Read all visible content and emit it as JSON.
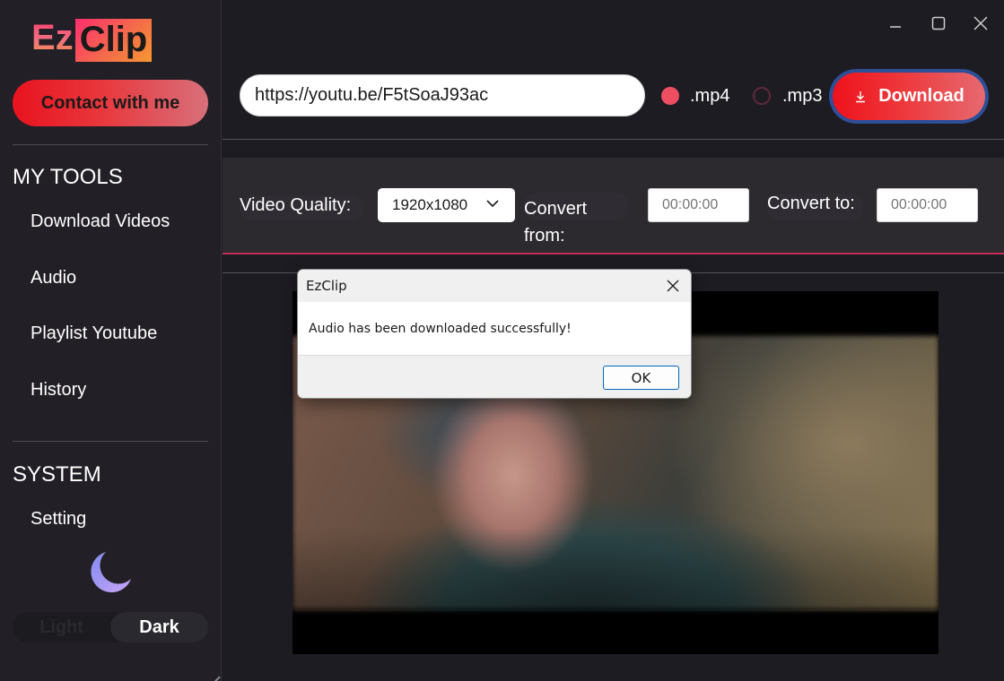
{
  "app": {
    "logo_left": "Ez",
    "logo_right": "Clip"
  },
  "sidebar": {
    "contact_label": "Contact with me",
    "tools_heading": "MY TOOLS",
    "tools": [
      {
        "label": "Download Videos"
      },
      {
        "label": "Audio"
      },
      {
        "label": "Playlist Youtube"
      },
      {
        "label": "History"
      }
    ],
    "system_heading": "SYSTEM",
    "system_items": [
      {
        "label": "Setting"
      }
    ],
    "theme": {
      "icon": "moon-icon",
      "light_label": "Light",
      "dark_label": "Dark",
      "selected": "Dark"
    }
  },
  "window_controls": {
    "minimize_icon": "minimize-icon",
    "maximize_icon": "maximize-icon",
    "close_icon": "close-icon"
  },
  "toolbar": {
    "url_value": "https://youtu.be/F5tSoaJ93ac",
    "format_options": [
      {
        "label": ".mp4",
        "selected": true
      },
      {
        "label": ".mp3",
        "selected": false
      }
    ],
    "download_label": "Download",
    "download_icon": "download-icon"
  },
  "settings": {
    "quality_label": "Video Quality:",
    "quality_value": "1920x1080",
    "convert_from_label_line1": "Convert",
    "convert_from_label_line2": "from:",
    "convert_from_placeholder": "00:00:00",
    "convert_to_label": "Convert to:",
    "convert_to_placeholder": "00:00:00"
  },
  "dialog": {
    "title": "EzClip",
    "message": "Audio has been downloaded successfully!",
    "ok_label": "OK"
  },
  "colors": {
    "background": "#1e1c23",
    "sidebar": "#222026",
    "accent_red": "#ee121c",
    "accent_blue_border": "#2c4f97",
    "radio_selected": "#ef4d62",
    "divider_pink": "#c1305a"
  }
}
